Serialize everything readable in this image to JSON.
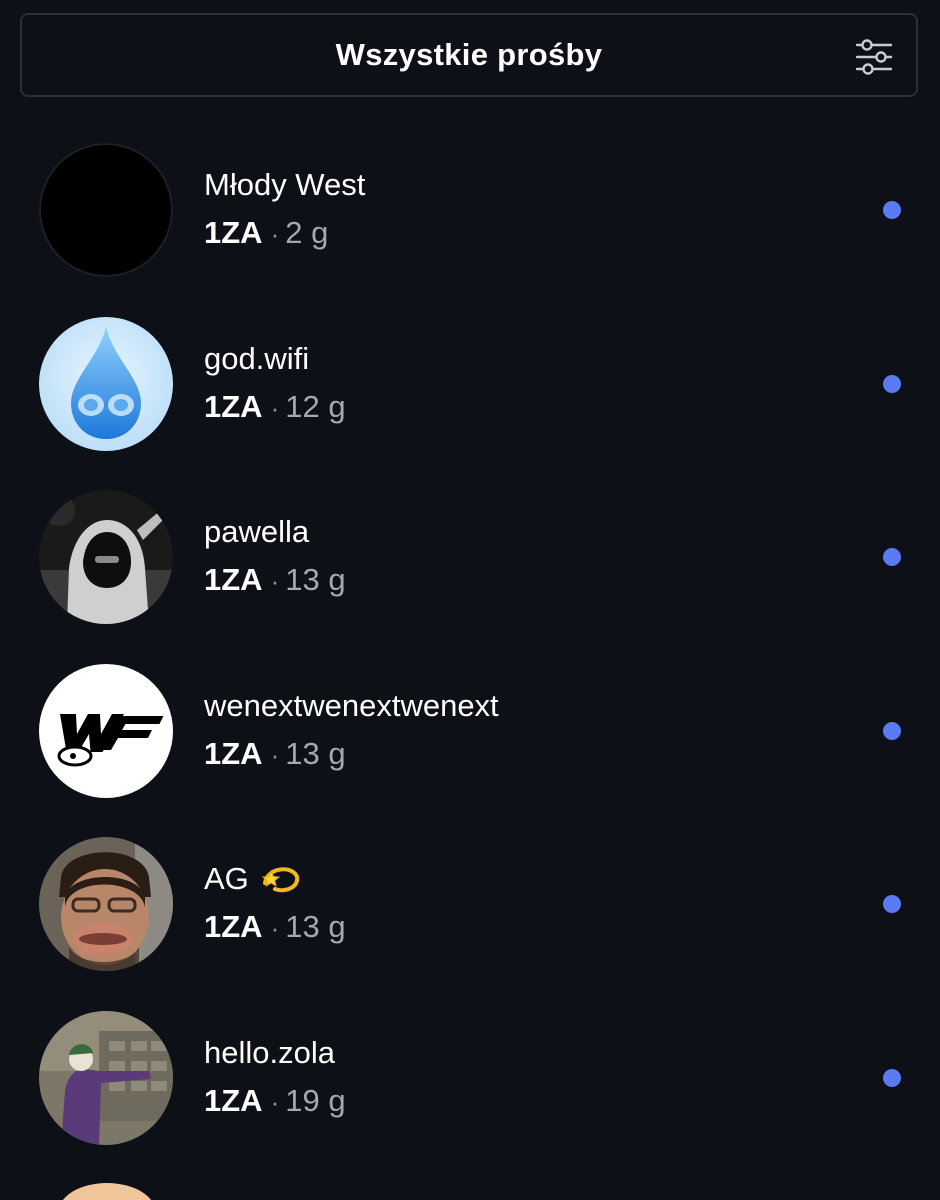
{
  "header": {
    "title": "Wszystkie prośby",
    "filter_icon": "sliders-icon"
  },
  "requests": [
    {
      "name": "Młody West",
      "badge": "1ZA",
      "separator": "·",
      "age": "2 g",
      "unread": true,
      "avatar": "black-avatar"
    },
    {
      "name": "god.wifi",
      "badge": "1ZA",
      "separator": "·",
      "age": "12 g",
      "unread": true,
      "avatar": "water-drop-avatar"
    },
    {
      "name": "pawella",
      "badge": "1ZA",
      "separator": "·",
      "age": "13 g",
      "unread": true,
      "avatar": "hooded-person-avatar"
    },
    {
      "name": "wenextwenextwenext",
      "badge": "1ZA",
      "separator": "·",
      "age": "13 g",
      "unread": true,
      "avatar": "wenext-logo-avatar"
    },
    {
      "name": "AG",
      "badge": "1ZA",
      "separator": "·",
      "age": "13 g",
      "unread": true,
      "avatar": "face-avatar",
      "emoji": "dizzy-star-emoji"
    },
    {
      "name": "hello.zola",
      "badge": "1ZA",
      "separator": "·",
      "age": "19 g",
      "unread": true,
      "avatar": "joker-avatar"
    }
  ],
  "colors": {
    "background": "#0d1016",
    "border": "#2b2f36",
    "unread_dot": "#5a7bf2",
    "secondary_text": "#a4a8b0"
  }
}
